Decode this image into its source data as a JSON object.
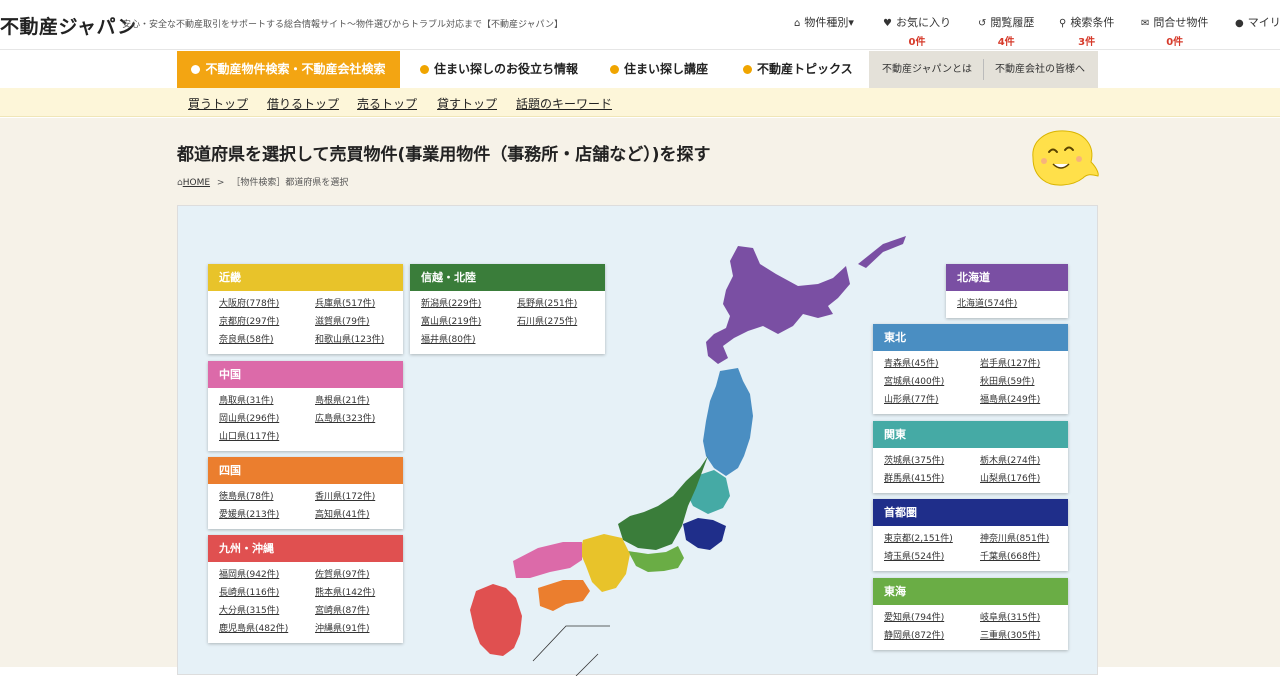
{
  "header": {
    "logo": "不動産ジャパン",
    "tagline": "安心・安全な不動産取引をサポートする総合情報サイト～物件選びからトラブル対応まで【不動産ジャパン】",
    "nav": [
      {
        "label": "物件種別▾",
        "icon": "house-icon",
        "count": ""
      },
      {
        "label": "お気に入り",
        "icon": "heart-icon",
        "count": "0件"
      },
      {
        "label": "閲覧履歴",
        "icon": "history-icon",
        "count": "4件"
      },
      {
        "label": "検索条件",
        "icon": "search-icon",
        "count": "3件"
      },
      {
        "label": "問合せ物件",
        "icon": "mail-icon",
        "count": "0件"
      },
      {
        "label": "マイリ",
        "icon": "user-icon",
        "count": ""
      }
    ]
  },
  "main_nav": {
    "active": "不動産物件検索・不動産会社検索",
    "items": [
      "住まい探しのお役立ち情報",
      "住まい探し講座",
      "不動産トピックス"
    ],
    "about": "不動産ジャパンとは",
    "business": "不動産会社の皆様へ"
  },
  "sub_nav": [
    "買うトップ",
    "借りるトップ",
    "売るトップ",
    "貸すトップ",
    "話題のキーワード"
  ],
  "page": {
    "title": "都道府県を選択して売買物件(事業用物件（事務所・店舗など）)を探す",
    "breadcrumb_home": "HOME",
    "breadcrumb_sep": ">",
    "breadcrumb_current": "［物件検索］都道府県を選択"
  },
  "colors": {
    "accent": "#f3a512",
    "kinki": "#e8c32a",
    "chugoku": "#dc6aa9",
    "shikoku": "#eb7e2e",
    "kyushu": "#e05050",
    "shinetsu": "#3a7d3a",
    "hokkaido": "#7a4fa3",
    "tohoku": "#4a8ec2",
    "kanto": "#45aaa5",
    "shutoken": "#1f2e8a",
    "tokai": "#6aad45"
  },
  "regions": {
    "kinki": {
      "name": "近畿",
      "prefs": [
        "大阪府(778件)",
        "兵庫県(517件)",
        "京都府(297件)",
        "滋賀県(79件)",
        "奈良県(58件)",
        "和歌山県(123件)"
      ]
    },
    "chugoku": {
      "name": "中国",
      "prefs": [
        "鳥取県(31件)",
        "島根県(21件)",
        "岡山県(296件)",
        "広島県(323件)",
        "山口県(117件)"
      ]
    },
    "shikoku": {
      "name": "四国",
      "prefs": [
        "徳島県(78件)",
        "香川県(172件)",
        "愛媛県(213件)",
        "高知県(41件)"
      ]
    },
    "kyushu": {
      "name": "九州・沖縄",
      "prefs": [
        "福岡県(942件)",
        "佐賀県(97件)",
        "長崎県(116件)",
        "熊本県(142件)",
        "大分県(315件)",
        "宮崎県(87件)",
        "鹿児島県(482件)",
        "沖縄県(91件)"
      ]
    },
    "shinetsu": {
      "name": "信越・北陸",
      "prefs": [
        "新潟県(229件)",
        "長野県(251件)",
        "富山県(219件)",
        "石川県(275件)",
        "福井県(80件)"
      ]
    },
    "hokkaido": {
      "name": "北海道",
      "prefs": [
        "北海道(574件)"
      ]
    },
    "tohoku": {
      "name": "東北",
      "prefs": [
        "青森県(45件)",
        "岩手県(127件)",
        "宮城県(400件)",
        "秋田県(59件)",
        "山形県(77件)",
        "福島県(249件)"
      ]
    },
    "kanto": {
      "name": "関東",
      "prefs": [
        "茨城県(375件)",
        "栃木県(274件)",
        "群馬県(415件)",
        "山梨県(176件)"
      ]
    },
    "shutoken": {
      "name": "首都圏",
      "prefs": [
        "東京都(2,151件)",
        "神奈川県(851件)",
        "埼玉県(524件)",
        "千葉県(668件)"
      ]
    },
    "tokai": {
      "name": "東海",
      "prefs": [
        "愛知県(794件)",
        "岐阜県(315件)",
        "静岡県(872件)",
        "三重県(305件)"
      ]
    }
  }
}
